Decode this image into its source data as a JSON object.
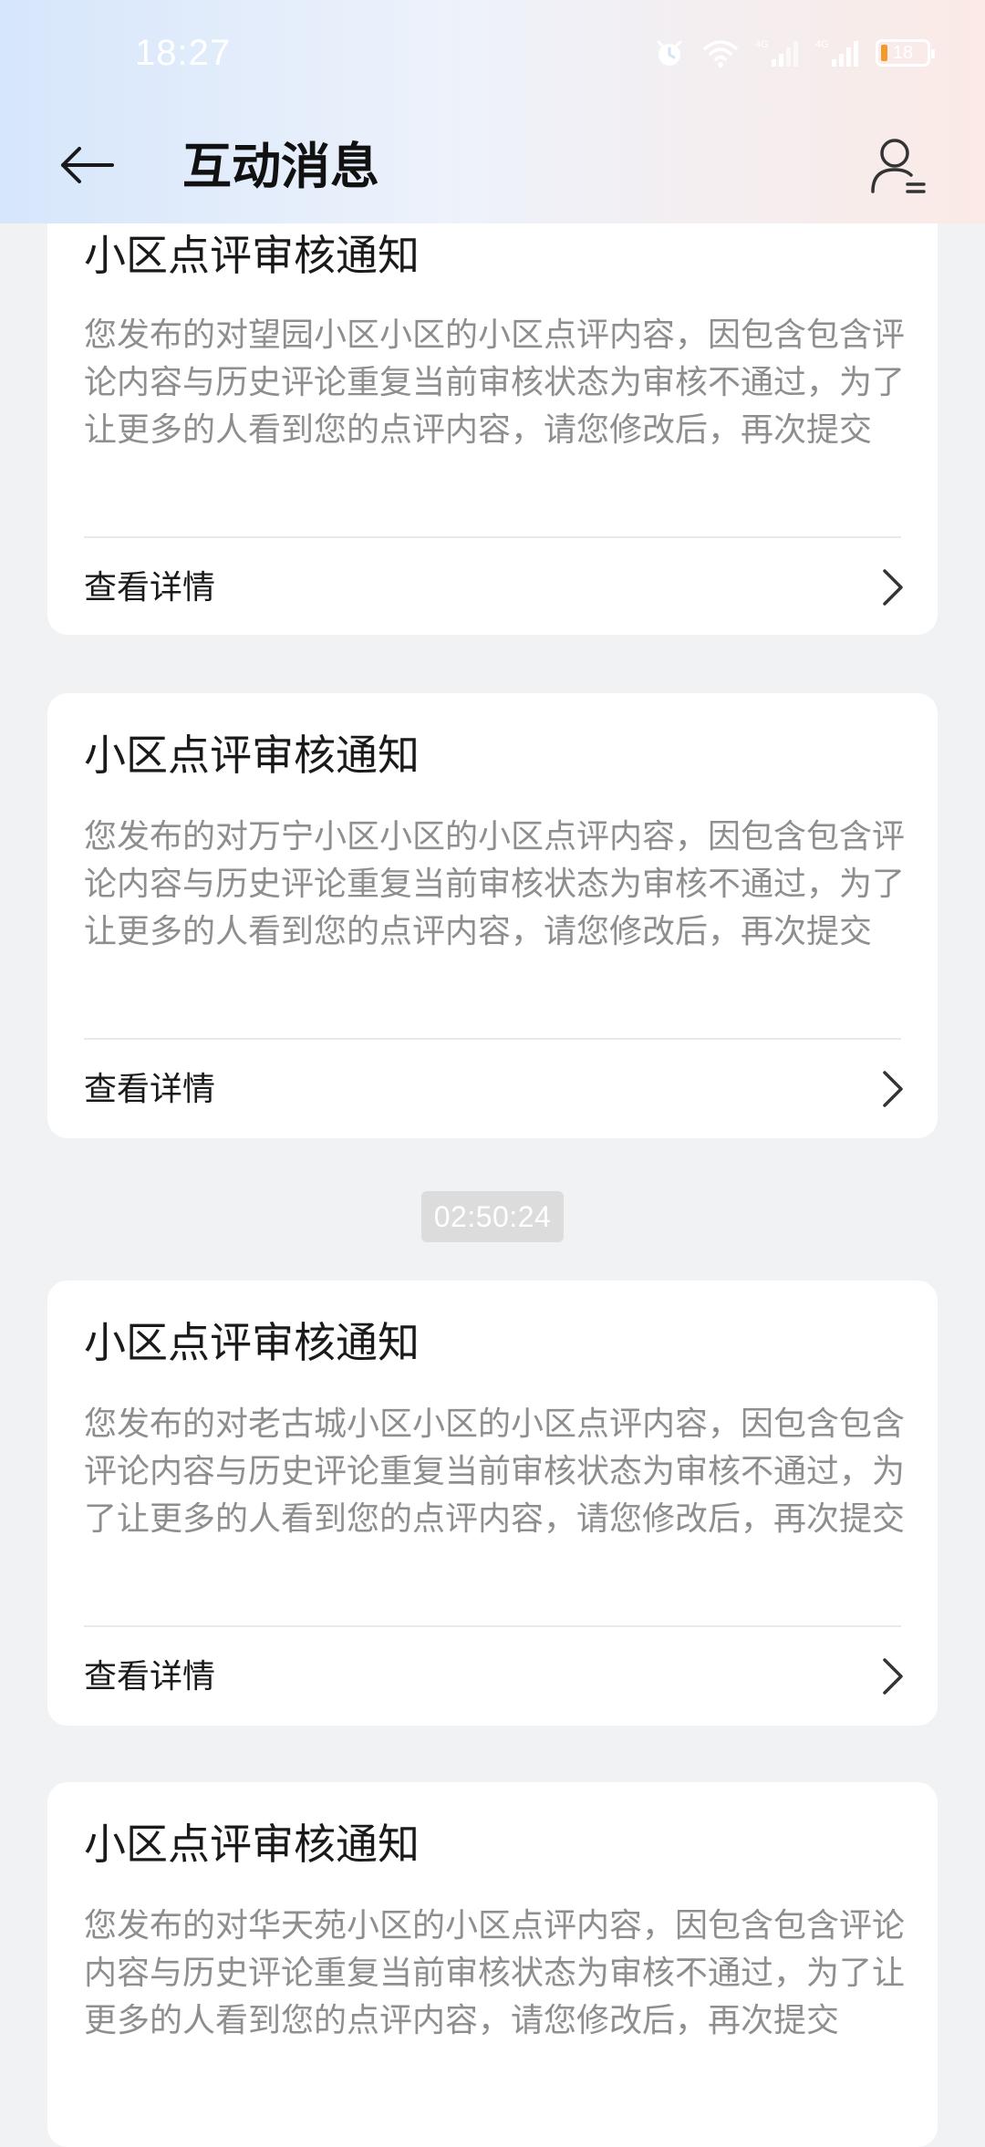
{
  "status_bar": {
    "time": "18:27",
    "network_1": "4G",
    "network_2": "4G",
    "battery": "18",
    "battery_color": "#f39a2e"
  },
  "header": {
    "title": "互动消息",
    "back_icon": "back-arrow-icon",
    "profile_icon": "user-settings-icon"
  },
  "timestamp": "02:50:24",
  "cards": [
    {
      "title": "小区点评审核通知",
      "body": "您发布的对望园小区小区的小区点评内容，因包含包含评论内容与历史评论重复当前审核状态为审核不通过，为了让更多的人看到您的点评内容，请您修改后，再次提交",
      "link": "查看详情"
    },
    {
      "title": "小区点评审核通知",
      "body": "您发布的对万宁小区小区的小区点评内容，因包含包含评论内容与历史评论重复当前审核状态为审核不通过，为了让更多的人看到您的点评内容，请您修改后，再次提交",
      "link": "查看详情"
    },
    {
      "title": "小区点评审核通知",
      "body": "您发布的对老古城小区小区的小区点评内容，因包含包含评论内容与历史评论重复当前审核状态为审核不通过，为了让更多的人看到您的点评内容，请您修改后，再次提交",
      "link": "查看详情"
    },
    {
      "title": "小区点评审核通知",
      "body": "您发布的对华天苑小区的小区点评内容，因包含包含评论内容与历史评论重复当前审核状态为审核不通过，为了让更多的人看到您的点评内容，请您修改后，再次提交",
      "link": ""
    }
  ]
}
